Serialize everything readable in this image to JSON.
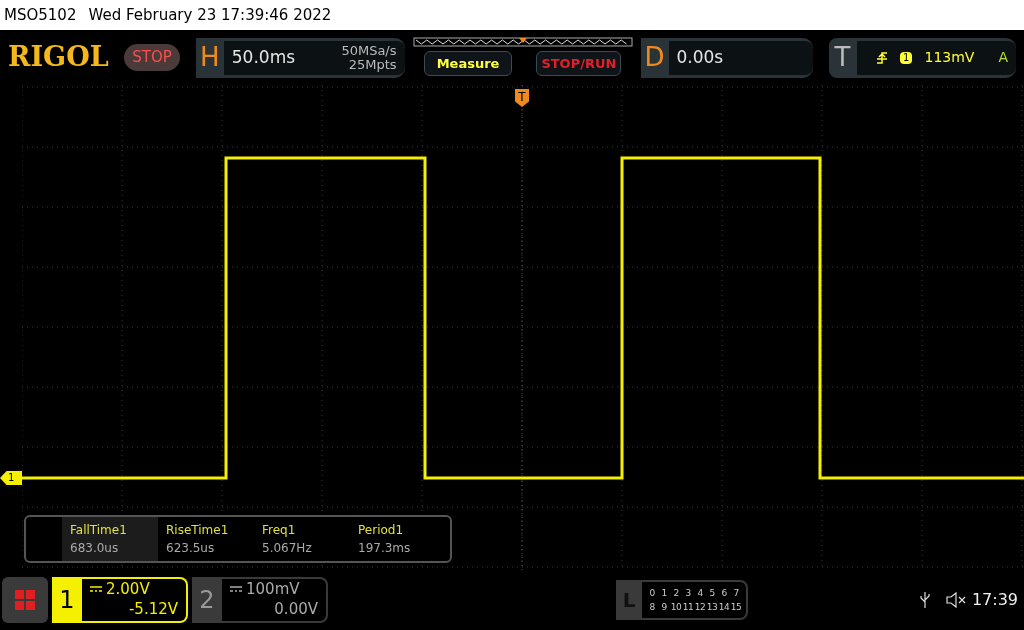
{
  "title_bar": {
    "model": "MSO5102",
    "datetime": "Wed February 23 17:39:46 2022"
  },
  "header": {
    "logo": "RIGOL",
    "run_state": "STOP",
    "horizontal": {
      "label": "H",
      "timebase": "50.0ms",
      "sample_rate": "50MSa/s",
      "memory": "25Mpts"
    },
    "measure_button": "Measure",
    "stop_run_button": "STOP/RUN",
    "delay": {
      "label": "D",
      "value": "0.00s"
    },
    "trigger": {
      "label": "T",
      "source": "1",
      "level": "113mV",
      "mode": "A"
    }
  },
  "screen": {
    "trigger_marker": "T",
    "channel_marker": "1"
  },
  "measurements": [
    {
      "name": "FallTime1",
      "value": "683.0us",
      "selected": true
    },
    {
      "name": "RiseTime1",
      "value": "623.5us",
      "selected": false
    },
    {
      "name": "Freq1",
      "value": "5.067Hz",
      "selected": false
    },
    {
      "name": "Period1",
      "value": "197.3ms",
      "selected": false
    }
  ],
  "channels": [
    {
      "number": "1",
      "scale": "2.00V",
      "offset": "-5.12V",
      "selected": true
    },
    {
      "number": "2",
      "scale": "100mV",
      "offset": "0.00V",
      "selected": false
    }
  ],
  "logic": {
    "label": "L",
    "rows": [
      [
        "0",
        "1",
        "2",
        "3",
        "4",
        "5",
        "6",
        "7"
      ],
      [
        "8",
        "9",
        "10",
        "11",
        "12",
        "13",
        "14",
        "15"
      ]
    ]
  },
  "status": {
    "time": "17:39"
  }
}
